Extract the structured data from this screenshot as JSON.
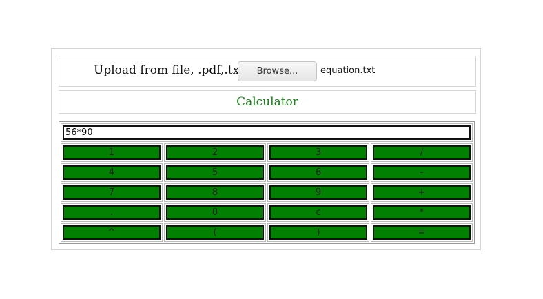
{
  "upload": {
    "label": "Upload from file, .pdf,.txt",
    "browse_label": "Browse...",
    "file_name": "equation.txt"
  },
  "calculator": {
    "title": "Calculator",
    "display_value": "56*90",
    "keys": [
      [
        "1",
        "2",
        "3",
        "/"
      ],
      [
        "4",
        "5",
        "6",
        "-"
      ],
      [
        "7",
        "8",
        "9",
        "+"
      ],
      [
        ".",
        "0",
        "c",
        "*"
      ],
      [
        "^",
        "(",
        ")",
        "="
      ]
    ]
  },
  "colors": {
    "key_background": "#028002",
    "title_text": "#148314"
  }
}
